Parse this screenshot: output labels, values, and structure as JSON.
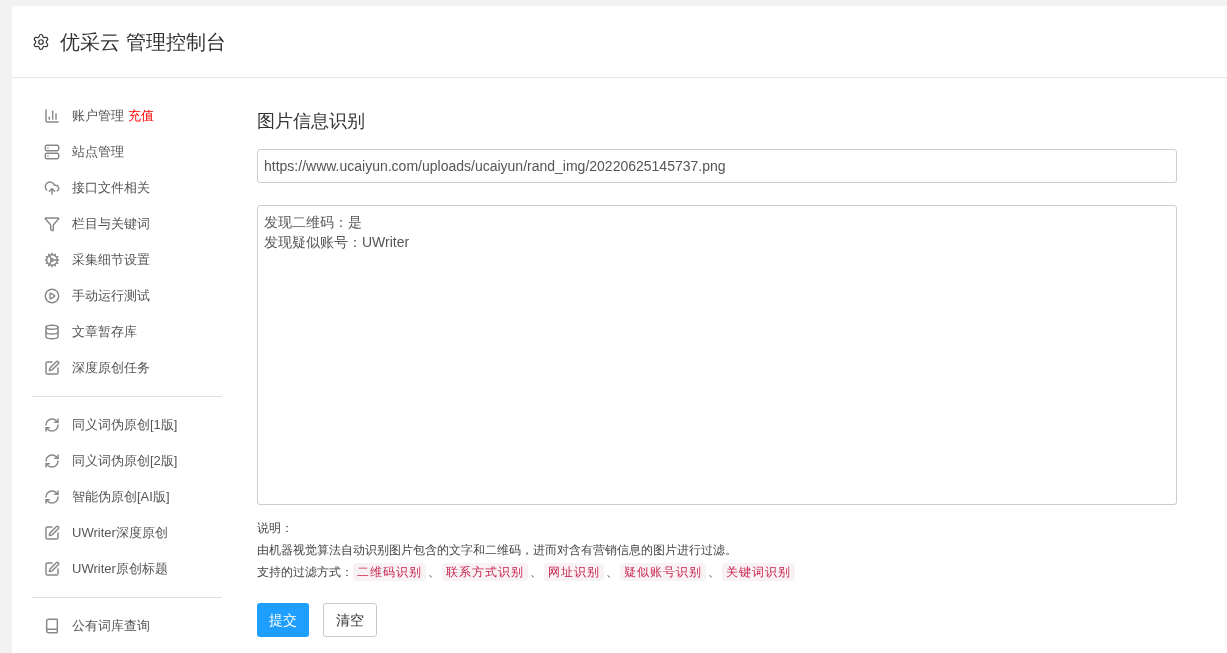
{
  "header": {
    "title": "优采云 管理控制台"
  },
  "sidebar": {
    "groups": [
      {
        "items": [
          {
            "label": "账户管理",
            "badge": "充值"
          },
          {
            "label": "站点管理"
          },
          {
            "label": "接口文件相关"
          },
          {
            "label": "栏目与关键词"
          },
          {
            "label": "采集细节设置"
          },
          {
            "label": "手动运行测试"
          },
          {
            "label": "文章暂存库"
          },
          {
            "label": "深度原创任务"
          }
        ]
      },
      {
        "items": [
          {
            "label": "同义词伪原创[1版]"
          },
          {
            "label": "同义词伪原创[2版]"
          },
          {
            "label": "智能伪原创[AI版]"
          },
          {
            "label": "UWriter深度原创"
          },
          {
            "label": "UWriter原创标题"
          }
        ]
      },
      {
        "items": [
          {
            "label": "公有词库查询"
          }
        ]
      }
    ]
  },
  "main": {
    "title": "图片信息识别",
    "url_field": {
      "value": "https://www.ucaiyun.com/uploads/ucaiyun/rand_img/20220625145737.png"
    },
    "result_box": {
      "lines": [
        "发现二维码：是",
        "发现疑似账号：UWriter"
      ]
    },
    "note_title": "说明：",
    "note_text": "由机器视觉算法自动识别图片包含的文字和二维码，进而对含有营销信息的图片进行过滤。",
    "methods_label": "支持的过滤方式：",
    "methods_separator": "、",
    "methods": [
      "二维码识别",
      "联系方式识别",
      "网址识别",
      "疑似账号识别",
      "关键词识别"
    ],
    "buttons": [
      {
        "label": "提交",
        "kind": "primary"
      },
      {
        "label": "清空",
        "kind": "default"
      }
    ]
  }
}
